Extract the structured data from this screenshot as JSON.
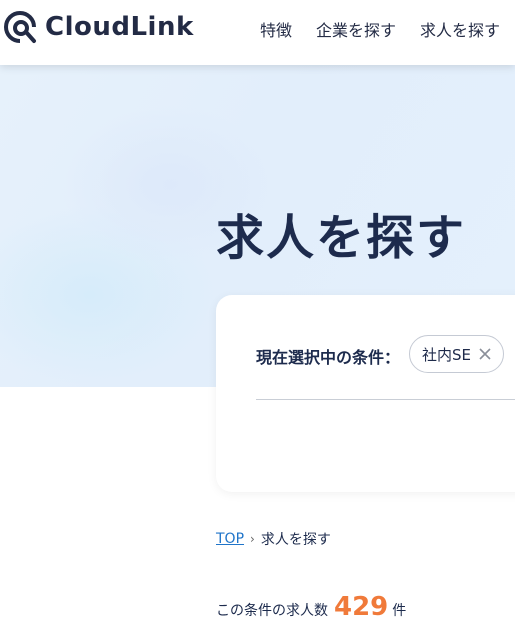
{
  "header": {
    "logo_text": "CloudLink",
    "nav": [
      "特徴",
      "企業を探す",
      "求人を探す"
    ]
  },
  "hero": {
    "title": "求人を探す"
  },
  "conditions": {
    "label": "現在選択中の条件：",
    "chips": [
      {
        "label": "社内SE"
      }
    ]
  },
  "breadcrumb": {
    "top": "TOP",
    "current": "求人を探す"
  },
  "count": {
    "prefix": "この条件の求人数",
    "value": "429",
    "unit": "件"
  },
  "colors": {
    "accent_orange": "#f07a3a",
    "link_blue": "#1f74c9",
    "navy": "#1d2b4d"
  },
  "icons": {
    "logo": "cloudlink-logo-icon",
    "chip_close": "close-icon",
    "breadcrumb_sep": "chevron-right-icon"
  }
}
